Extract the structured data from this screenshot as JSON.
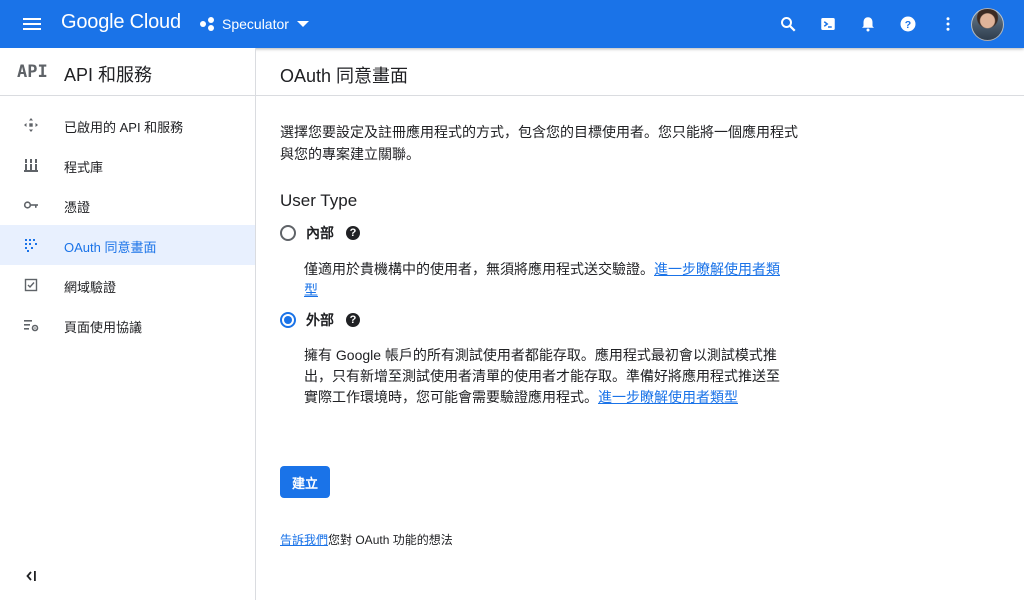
{
  "topbar": {
    "logo_text": "Google Cloud",
    "project_name": "Speculator",
    "icons": [
      "menu-icon",
      "search-icon",
      "cloud-shell-icon",
      "notifications-icon",
      "help-icon",
      "more-vert-icon",
      "avatar"
    ],
    "brand_color": "#1a73e8"
  },
  "sidebar": {
    "logo": "API",
    "title": "API 和服務",
    "items": [
      {
        "label": "已啟用的 API 和服務",
        "icon": "dashboard-icon",
        "active": false
      },
      {
        "label": "程式庫",
        "icon": "library-icon",
        "active": false
      },
      {
        "label": "憑證",
        "icon": "key-icon",
        "active": false
      },
      {
        "label": "OAuth 同意畫面",
        "icon": "consent-icon",
        "active": true
      },
      {
        "label": "網域驗證",
        "icon": "checkbox-icon",
        "active": false
      },
      {
        "label": "頁面使用協議",
        "icon": "settings-list-icon",
        "active": false
      }
    ],
    "collapse_icon": "collapse-left-icon"
  },
  "main": {
    "title": "OAuth 同意畫面",
    "intro": "選擇您要設定及註冊應用程式的方式，包含您的目標使用者。您只能將一個應用程式與您的專案建立關聯。",
    "user_type_heading": "User Type",
    "options": [
      {
        "label": "內部",
        "checked": false,
        "description": "僅適用於貴機構中的使用者，無須將應用程式送交驗證。",
        "link": "進一步瞭解使用者類型"
      },
      {
        "label": "外部",
        "checked": true,
        "description": "擁有 Google 帳戶的所有測試使用者都能存取。應用程式最初會以測試模式推出，只有新增至測試使用者清單的使用者才能存取。準備好將應用程式推送至實際工作環境時，您可能會需要驗證應用程式。",
        "link": "進一步瞭解使用者類型"
      }
    ],
    "create_button": "建立",
    "feedback_link": "告訴我們",
    "feedback_text": "您對 OAuth 功能的想法"
  }
}
